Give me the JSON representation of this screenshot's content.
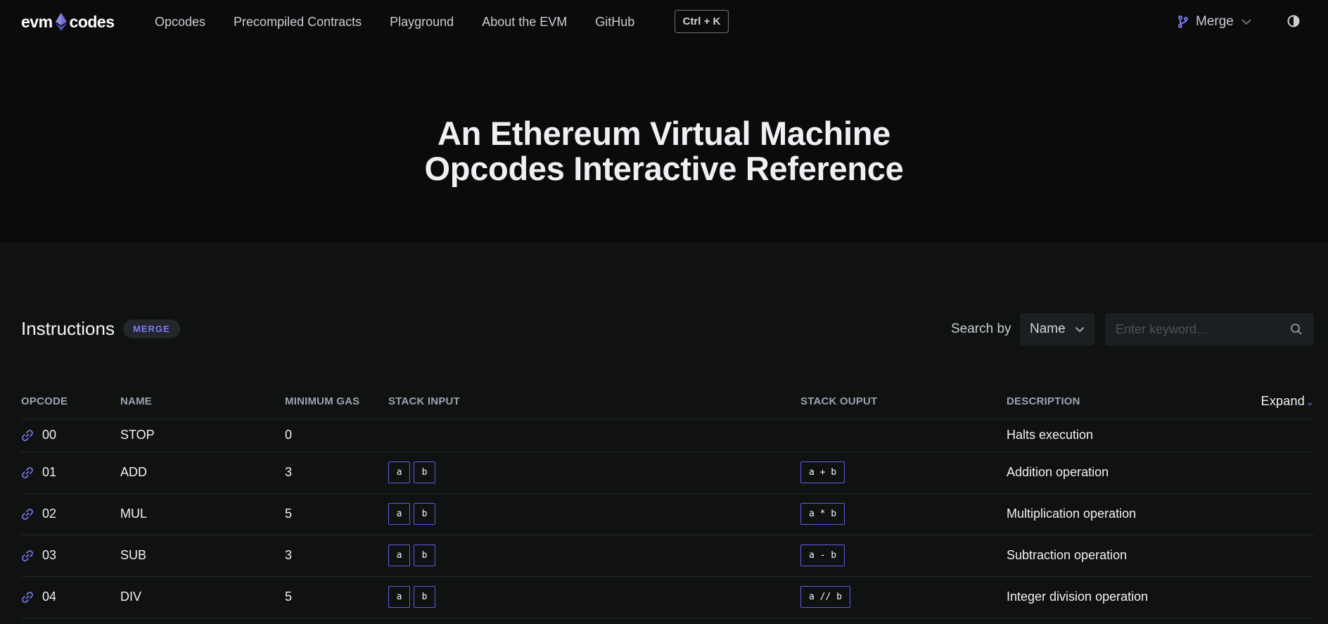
{
  "nav": {
    "logo_left": "evm",
    "logo_right": "codes",
    "links": [
      "Opcodes",
      "Precompiled Contracts",
      "Playground",
      "About the EVM",
      "GitHub"
    ],
    "shortcut": "Ctrl + K",
    "fork": "Merge",
    "icons": {
      "fork": "git-branch-icon",
      "theme": "theme-toggle-icon",
      "chevron": "chevron-down-icon"
    }
  },
  "hero": {
    "line1": "An Ethereum Virtual Machine",
    "line2": "Opcodes Interactive Reference"
  },
  "instructions": {
    "title": "Instructions",
    "badge": "MERGE",
    "search_label": "Search by",
    "search_by": "Name",
    "search_placeholder": "Enter keyword...",
    "expand_label": "Expand"
  },
  "table": {
    "headers": [
      "OPCODE",
      "NAME",
      "MINIMUM GAS",
      "STACK INPUT",
      "STACK OUPUT",
      "DESCRIPTION"
    ],
    "rows": [
      {
        "opcode": "00",
        "name": "STOP",
        "gas": "0",
        "input": [],
        "output": "",
        "description": "Halts execution"
      },
      {
        "opcode": "01",
        "name": "ADD",
        "gas": "3",
        "input": [
          "a",
          "b"
        ],
        "output": "a + b",
        "description": "Addition operation"
      },
      {
        "opcode": "02",
        "name": "MUL",
        "gas": "5",
        "input": [
          "a",
          "b"
        ],
        "output": "a * b",
        "description": "Multiplication operation"
      },
      {
        "opcode": "03",
        "name": "SUB",
        "gas": "3",
        "input": [
          "a",
          "b"
        ],
        "output": "a - b",
        "description": "Subtraction operation"
      },
      {
        "opcode": "04",
        "name": "DIV",
        "gas": "5",
        "input": [
          "a",
          "b"
        ],
        "output": "a // b",
        "description": "Integer division operation"
      }
    ]
  },
  "colors": {
    "accent": "#5d5ee0",
    "background": "#101212",
    "header_background": "#0b0b0b"
  }
}
